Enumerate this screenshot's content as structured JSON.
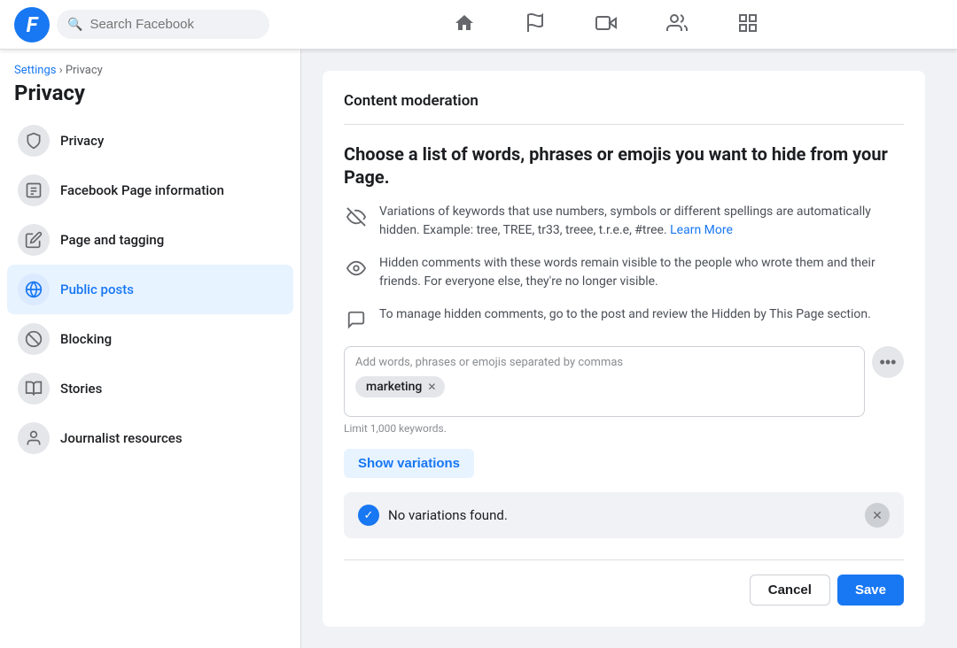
{
  "app": {
    "name": "Facebook",
    "logo_letter": "f"
  },
  "topnav": {
    "search_placeholder": "Search Facebook"
  },
  "nav_icons": [
    {
      "name": "home-icon",
      "label": "Home"
    },
    {
      "name": "flag-icon",
      "label": "Pages"
    },
    {
      "name": "video-icon",
      "label": "Watch"
    },
    {
      "name": "friends-icon",
      "label": "Friends"
    },
    {
      "name": "grid-icon",
      "label": "Menu"
    }
  ],
  "sidebar": {
    "breadcrumb_settings": "Settings",
    "breadcrumb_separator": " › ",
    "breadcrumb_privacy": "Privacy",
    "page_title": "Privacy",
    "items": [
      {
        "id": "privacy",
        "label": "Privacy",
        "icon": "🔒"
      },
      {
        "id": "fb-page-info",
        "label": "Facebook Page information",
        "icon": "📋"
      },
      {
        "id": "page-tagging",
        "label": "Page and tagging",
        "icon": "✏️"
      },
      {
        "id": "public-posts",
        "label": "Public posts",
        "icon": "🌐",
        "active": true
      },
      {
        "id": "blocking",
        "label": "Blocking",
        "icon": "🚫"
      },
      {
        "id": "stories",
        "label": "Stories",
        "icon": "📖"
      },
      {
        "id": "journalist",
        "label": "Journalist resources",
        "icon": "👤"
      }
    ]
  },
  "main": {
    "section_label": "Content moderation",
    "moderation_title": "Choose a list of words, phrases or emojis you want to hide from your Page.",
    "info_rows": [
      {
        "id": "variations-info",
        "icon": "eye-slash",
        "text": "Variations of keywords that use numbers, symbols or different spellings are automatically hidden. Example: tree, TREE, tr33, treee, t.r.e.e, #tree.",
        "link_text": "Learn More",
        "link_href": "#"
      },
      {
        "id": "hidden-comments-info",
        "icon": "eye",
        "text": "Hidden comments with these words remain visible to the people who wrote them and their friends. For everyone else, they're no longer visible."
      },
      {
        "id": "manage-hidden-info",
        "icon": "comment",
        "text": "To manage hidden comments, go to the post and review the Hidden by This Page section."
      }
    ],
    "keyword_placeholder": "Add words, phrases or emojis separated by commas",
    "keyword_tags": [
      {
        "id": "marketing",
        "label": "marketing"
      }
    ],
    "keyword_limit_text": "Limit 1,000 keywords.",
    "show_variations_label": "Show variations",
    "no_variations_text": "No variations found.",
    "cancel_label": "Cancel",
    "save_label": "Save"
  }
}
